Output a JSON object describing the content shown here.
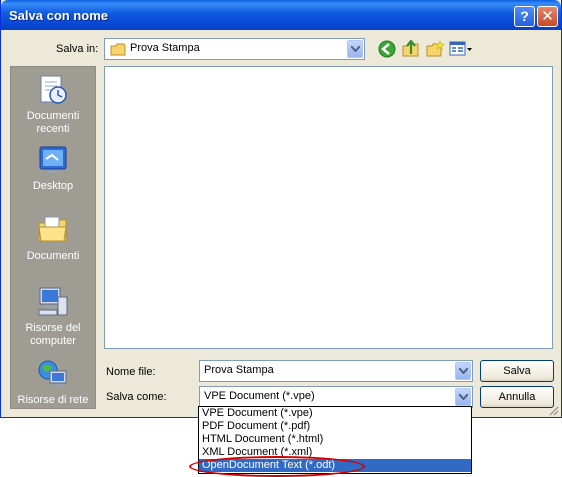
{
  "window": {
    "title": "Salva con nome"
  },
  "titlebar": {
    "help_label": "?",
    "close_label": "✕"
  },
  "toolbar": {
    "save_in_label": "Salva in:",
    "save_in_value": "Prova Stampa",
    "icons": [
      "back-icon",
      "up-folder-icon",
      "new-folder-icon",
      "view-menu-icon"
    ]
  },
  "places": [
    {
      "label": "Documenti recenti",
      "icon": "recent-documents-icon"
    },
    {
      "label": "Desktop",
      "icon": "desktop-icon"
    },
    {
      "label": "Documenti",
      "icon": "documents-folder-icon"
    },
    {
      "label": "Risorse del computer",
      "icon": "my-computer-icon"
    },
    {
      "label": "Risorse di rete",
      "icon": "network-icon"
    }
  ],
  "form": {
    "filename_label": "Nome file:",
    "filename_value": "Prova Stampa",
    "filetype_label": "Salva come:",
    "filetype_value": "VPE Document (*.vpe)"
  },
  "buttons": {
    "save": "Salva",
    "cancel": "Annulla"
  },
  "filetype_options": [
    "VPE Document (*.vpe)",
    "PDF Document (*.pdf)",
    "HTML Document (*.html)",
    "XML Document (*.xml)",
    "OpenDocument Text (*.odt)"
  ],
  "selected_option_index": 4,
  "colors": {
    "titlebar": "#0a5fe0",
    "selection": "#316ac5",
    "annotation": "#d00000"
  }
}
